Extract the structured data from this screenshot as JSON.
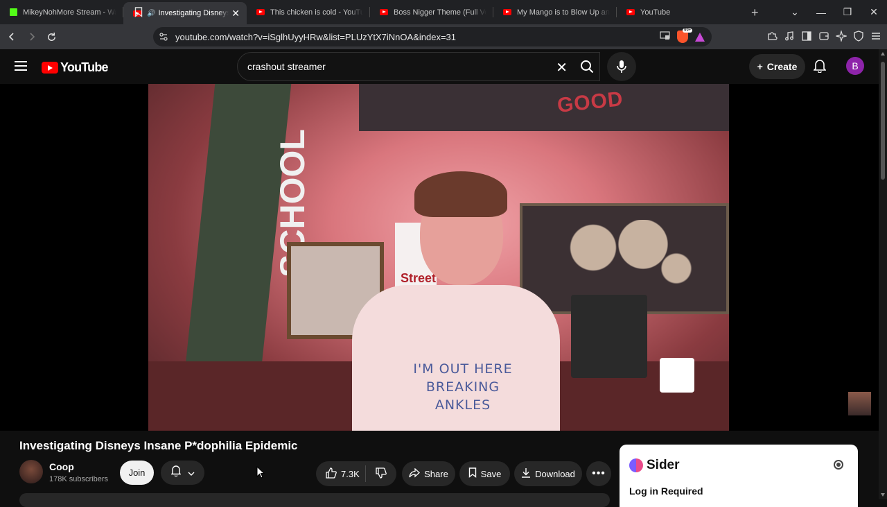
{
  "browser": {
    "tabs": [
      {
        "title": "MikeyNohMore Stream - Watch",
        "favicon": "kick-icon"
      },
      {
        "title": "Investigating Disneys In",
        "favicon": "youtube-icon",
        "active": true,
        "audio": true
      },
      {
        "title": "This chicken is cold - YouTube",
        "favicon": "youtube-icon"
      },
      {
        "title": "Boss Nigger Theme (Full Versio",
        "favicon": "youtube-icon"
      },
      {
        "title": "My Mango is to Blow Up and T",
        "favicon": "youtube-icon"
      },
      {
        "title": "YouTube",
        "favicon": "youtube-icon"
      }
    ],
    "url": "youtube.com/watch?v=iSglhUyyHRw&list=PLUzYtX7iNnOA&index=31",
    "brave_badge": "99+"
  },
  "youtube": {
    "logo_text": "YouTube",
    "search_value": "crashout streamer",
    "create_label": "Create",
    "avatar_letter": "B"
  },
  "video": {
    "shirt_text_line1": "I'M OUT HERE",
    "shirt_text_line2": "BREAKING ANKLES",
    "board_text": "SCHOOL",
    "banner_text": "GOOD",
    "sign_text": "Street",
    "title": "Investigating Disneys Insane P*dophilia Epidemic"
  },
  "channel": {
    "name": "Coop",
    "subscribers": "178K subscribers",
    "join_label": "Join"
  },
  "actions": {
    "likes": "7.3K",
    "share_label": "Share",
    "save_label": "Save",
    "download_label": "Download"
  },
  "sider": {
    "name": "Sider",
    "login_text": "Log in Required"
  },
  "colors": {
    "yt_red": "#ff0000",
    "bg": "#0f0f0f",
    "pill": "#272727",
    "avatar": "#8e24aa"
  }
}
